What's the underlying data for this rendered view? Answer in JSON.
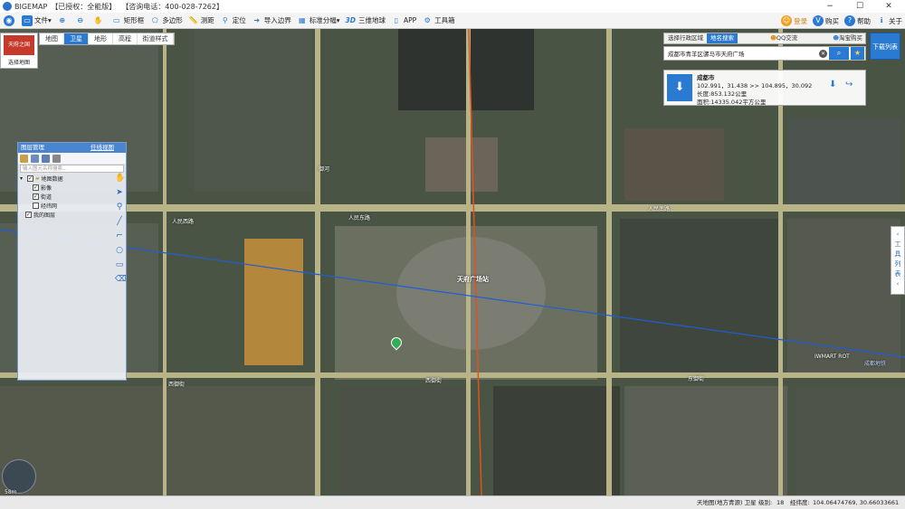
{
  "titlebar": {
    "app_name": "BIGEMAP",
    "license": "【已授权：全能版】",
    "phone": "【咨询电话：400-028-7262】",
    "min": "−",
    "max": "☐",
    "close": "✕"
  },
  "toolbar": {
    "file": "文件",
    "rect": "矩形框",
    "poly": "多边形",
    "measure": "测距",
    "locate": "定位",
    "import_boundary": "导入边界",
    "grid": "标准分幅",
    "three_d_badge": "3D",
    "three_d": "三维地球",
    "app": "APP",
    "toolbox": "工具箱",
    "login": "登录",
    "buy": "购买",
    "help": "帮助",
    "about": "关于"
  },
  "map_tabs": [
    "地图",
    "卫星",
    "地形",
    "高程",
    "街道样式"
  ],
  "map_tabs_active": 1,
  "city_logo": {
    "title": "天府之国",
    "label": "选择地图"
  },
  "layer_panel": {
    "title": "图层管理",
    "switch_label": "任线视图",
    "search_placeholder": "输入图元名称搜索...",
    "tree": [
      {
        "label": "地图数据",
        "checked": true,
        "level": 0
      },
      {
        "label": "影像",
        "checked": true,
        "level": 1
      },
      {
        "label": "街道",
        "checked": true,
        "level": 1
      },
      {
        "label": "经纬网",
        "checked": false,
        "level": 1
      },
      {
        "label": "我的图层",
        "checked": true,
        "level": 0
      }
    ]
  },
  "region_panel": {
    "tab_region": "选择行政区域",
    "tab_search": "地名搜索",
    "qq": "QQ交流",
    "taobao": "淘宝购买",
    "search_value": "成都市青羊区骡马市天府广场",
    "result_title": "成都市",
    "result_bounds": "102.991，31.438 >> 104.895，30.092",
    "result_perimeter": "长度:853.132公里",
    "result_area": "面积:14335.042平方公里"
  },
  "download_button": "下载列表",
  "toolstrip": [
    "工",
    "具",
    "列",
    "表"
  ],
  "map_labels": {
    "square": "天府广场站",
    "east_road": "人民东路",
    "west_road": "人民西路",
    "xiyu_street": "西御街",
    "dongyu_street": "东御街",
    "xiyu_street2": "西御街",
    "renmin_south": "人民南路",
    "yu_he": "御河",
    "iwmart": "IWMART  ROT",
    "chengdu": "成都地铁"
  },
  "status": {
    "provider": "天地图(地方青源) 卫星",
    "zoom_label": "级别:",
    "zoom": "18",
    "lng_label": "经纬度:",
    "coords": "104.06474769, 30.66033661"
  },
  "scale_label": "58m",
  "colors": {
    "accent": "#2a7ad1",
    "road": "#b9b488",
    "route_line": "#1e5fd6",
    "meridian": "#e0521c"
  }
}
